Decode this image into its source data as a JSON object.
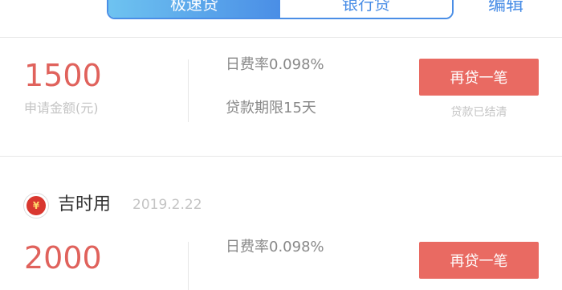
{
  "header": {
    "tabs": [
      {
        "label": "极速贷",
        "active": true
      },
      {
        "label": "银行贷",
        "active": false
      }
    ],
    "edit_label": "编辑"
  },
  "loans": [
    {
      "amount": "1500",
      "amount_label": "申请金额(元)",
      "rate": "日费率0.098%",
      "term": "贷款期限15天",
      "action_label": "再贷一笔",
      "status": "贷款已结清"
    },
    {
      "brand_name": "吉时用",
      "brand_logo_icon": "jishiyong-logo-icon",
      "date": "2019.2.22",
      "amount": "2000",
      "rate": "日费率0.098%",
      "action_label": "再贷一笔"
    }
  ],
  "colors": {
    "accent_blue": "#4a8ee6",
    "amount_red": "#e0625c",
    "button_red": "#e96a62"
  }
}
